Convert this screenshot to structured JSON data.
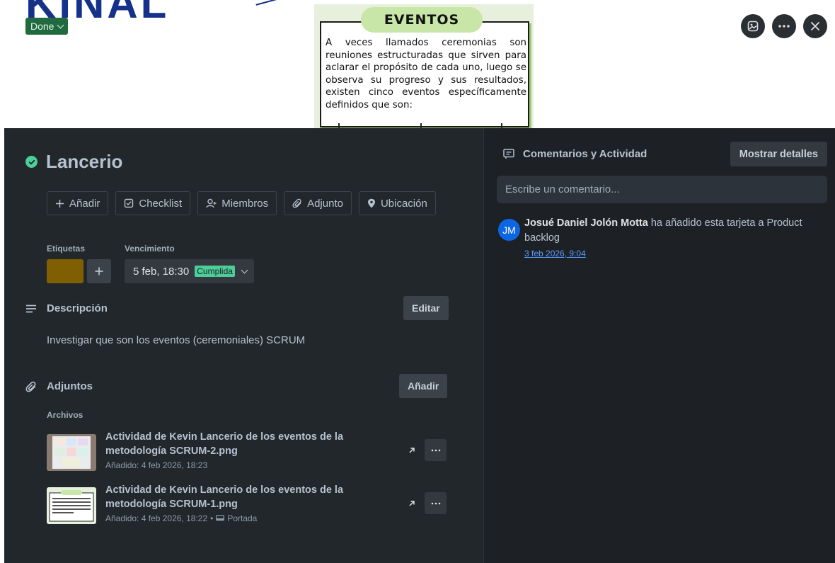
{
  "cover": {
    "poster_title": "EVENTOS",
    "poster_text": "A veces llamados ceremonias son reuniones estructuradas que sirven para aclarar el propósito de cada uno, luego se observa su progreso y sus resultados, existen cinco eventos específicamente definidos que son:",
    "status_label": "Done"
  },
  "card": {
    "title": "Lancerio",
    "actions": [
      {
        "label": "Añadir",
        "icon": "plus-icon"
      },
      {
        "label": "Checklist",
        "icon": "checkbox-icon"
      },
      {
        "label": "Miembros",
        "icon": "user-plus-icon"
      },
      {
        "label": "Adjunto",
        "icon": "paperclip-icon"
      },
      {
        "label": "Ubicación",
        "icon": "location-pin-icon"
      }
    ],
    "labels_heading": "Etiquetas",
    "label_color": "#7f5f01",
    "due_heading": "Vencimiento",
    "due_date": "5 feb, 18:30",
    "due_status": "Cumplida",
    "description_heading": "Descripción",
    "edit_label": "Editar",
    "description": "Investigar que son los eventos (ceremoniales) SCRUM",
    "attachments_heading": "Adjuntos",
    "add_label": "Añadir",
    "files_heading": "Archivos",
    "attachments": [
      {
        "name": "Actividad de Kevin Lancerio de los eventos de la metodología SCRUM-2.png",
        "added": "Añadido: 4 feb 2026, 18:23"
      },
      {
        "name": "Actividad de Kevin Lancerio de los eventos de la metodología SCRUM-1.png",
        "added": "Añadido: 4 feb 2026, 18:22",
        "extra": "Portada"
      }
    ],
    "meta_separator": "•"
  },
  "activity": {
    "heading": "Comentarios y Actividad",
    "show_details": "Mostrar detalles",
    "comment_placeholder": "Escribe un comentario...",
    "item": {
      "initials": "JM",
      "user": "Josué Daniel Jolón Motta",
      "text": " ha añadido esta tarjeta a Product backlog",
      "time": "3 feb 2026, 9:04"
    }
  }
}
